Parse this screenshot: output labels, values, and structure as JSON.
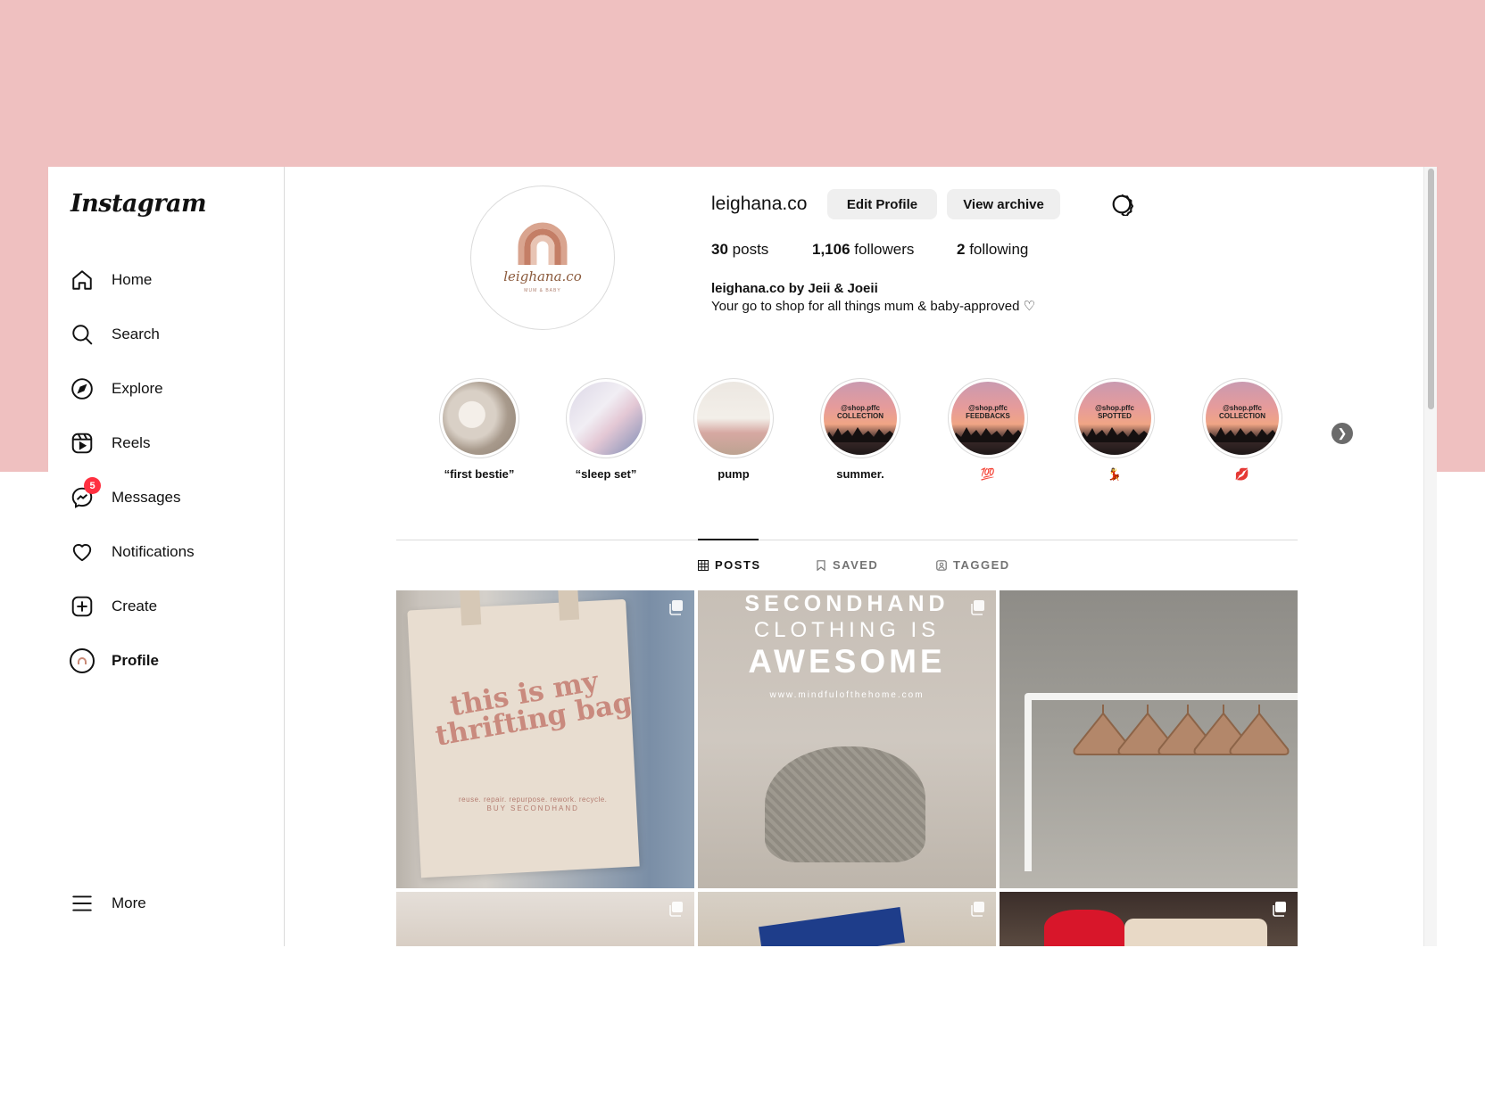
{
  "app": {
    "logo": "Instagram"
  },
  "sidebar": {
    "items": [
      {
        "label": "Home",
        "icon": "home-icon"
      },
      {
        "label": "Search",
        "icon": "search-icon"
      },
      {
        "label": "Explore",
        "icon": "compass-icon"
      },
      {
        "label": "Reels",
        "icon": "reels-icon"
      },
      {
        "label": "Messages",
        "icon": "messenger-icon",
        "badge": "5"
      },
      {
        "label": "Notifications",
        "icon": "heart-icon"
      },
      {
        "label": "Create",
        "icon": "plus-square-icon"
      },
      {
        "label": "Profile",
        "icon": "profile-avatar-icon"
      }
    ],
    "more_label": "More"
  },
  "profile": {
    "avatar_text": "leighana.co",
    "avatar_sub": "MUM & BABY",
    "username": "leighana.co",
    "edit_label": "Edit Profile",
    "archive_label": "View archive",
    "stats": {
      "posts_count": "30",
      "posts_label": "posts",
      "followers_count": "1,106",
      "followers_label": "followers",
      "following_count": "2",
      "following_label": "following"
    },
    "bio_name": "leighana.co by Jeii & Joeii",
    "bio_text": "Your go to shop for all things mum & baby-approved ♡"
  },
  "highlights": [
    {
      "label": "“first bestie”",
      "style": "photo"
    },
    {
      "label": "“sleep set”",
      "style": "photo"
    },
    {
      "label": "pump",
      "style": "photo"
    },
    {
      "label": "summer.",
      "style": "sunset",
      "overlay": "@shop.pffc\nCOLLECTION"
    },
    {
      "label": "💯",
      "style": "sunset",
      "overlay": "@shop.pffc\nFEEDBACKS"
    },
    {
      "label": "💃",
      "style": "sunset",
      "overlay": "@shop.pffc\nSPOTTED"
    },
    {
      "label": "💋",
      "style": "sunset",
      "overlay": "@shop.pffc\nCOLLECTION"
    }
  ],
  "tabs": [
    {
      "label": "POSTS",
      "icon": "grid-icon",
      "active": true
    },
    {
      "label": "SAVED",
      "icon": "bookmark-icon",
      "active": false
    },
    {
      "label": "TAGGED",
      "icon": "tagged-icon",
      "active": false
    }
  ],
  "posts": {
    "p1": {
      "line1": "this is my",
      "line2": "thrifting bag",
      "small1": "reuse. repair. repurpose. rework. recycle.",
      "small2": "BUY SECONDHAND"
    },
    "p2": {
      "line1": "SECONDHAND",
      "line2": "CLOTHING IS",
      "line3": "AWESOME",
      "url": "www.mindfulofthehome.com"
    }
  },
  "colors": {
    "background_pink": "#efc0c0",
    "badge_red": "#ff3040",
    "button_gray": "#efefef",
    "brand_brown": "#c98a7e"
  }
}
